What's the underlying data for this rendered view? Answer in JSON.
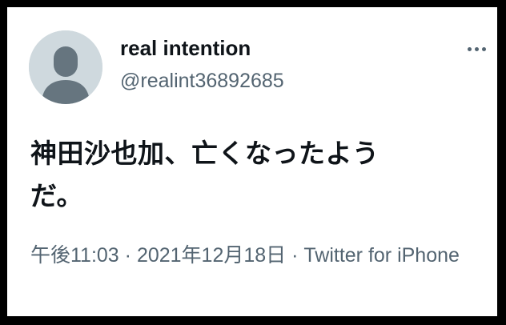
{
  "tweet": {
    "author": {
      "display_name": "real intention",
      "handle": "@realint36892685",
      "avatar_icon": "default-profile-icon"
    },
    "more_icon": "more-horizontal-icon",
    "text_line1": "神田沙也加、亡くなったよう",
    "text_line2": "だ。",
    "time": "午後11:03",
    "separator": " · ",
    "date": "2021年12月18日",
    "source": "Twitter for iPhone"
  },
  "colors": {
    "background": "#ffffff",
    "frame": "#000000",
    "text_primary": "#0f1419",
    "text_secondary": "#536471",
    "avatar_bg": "#cfd9de",
    "avatar_fg": "#66757f"
  }
}
